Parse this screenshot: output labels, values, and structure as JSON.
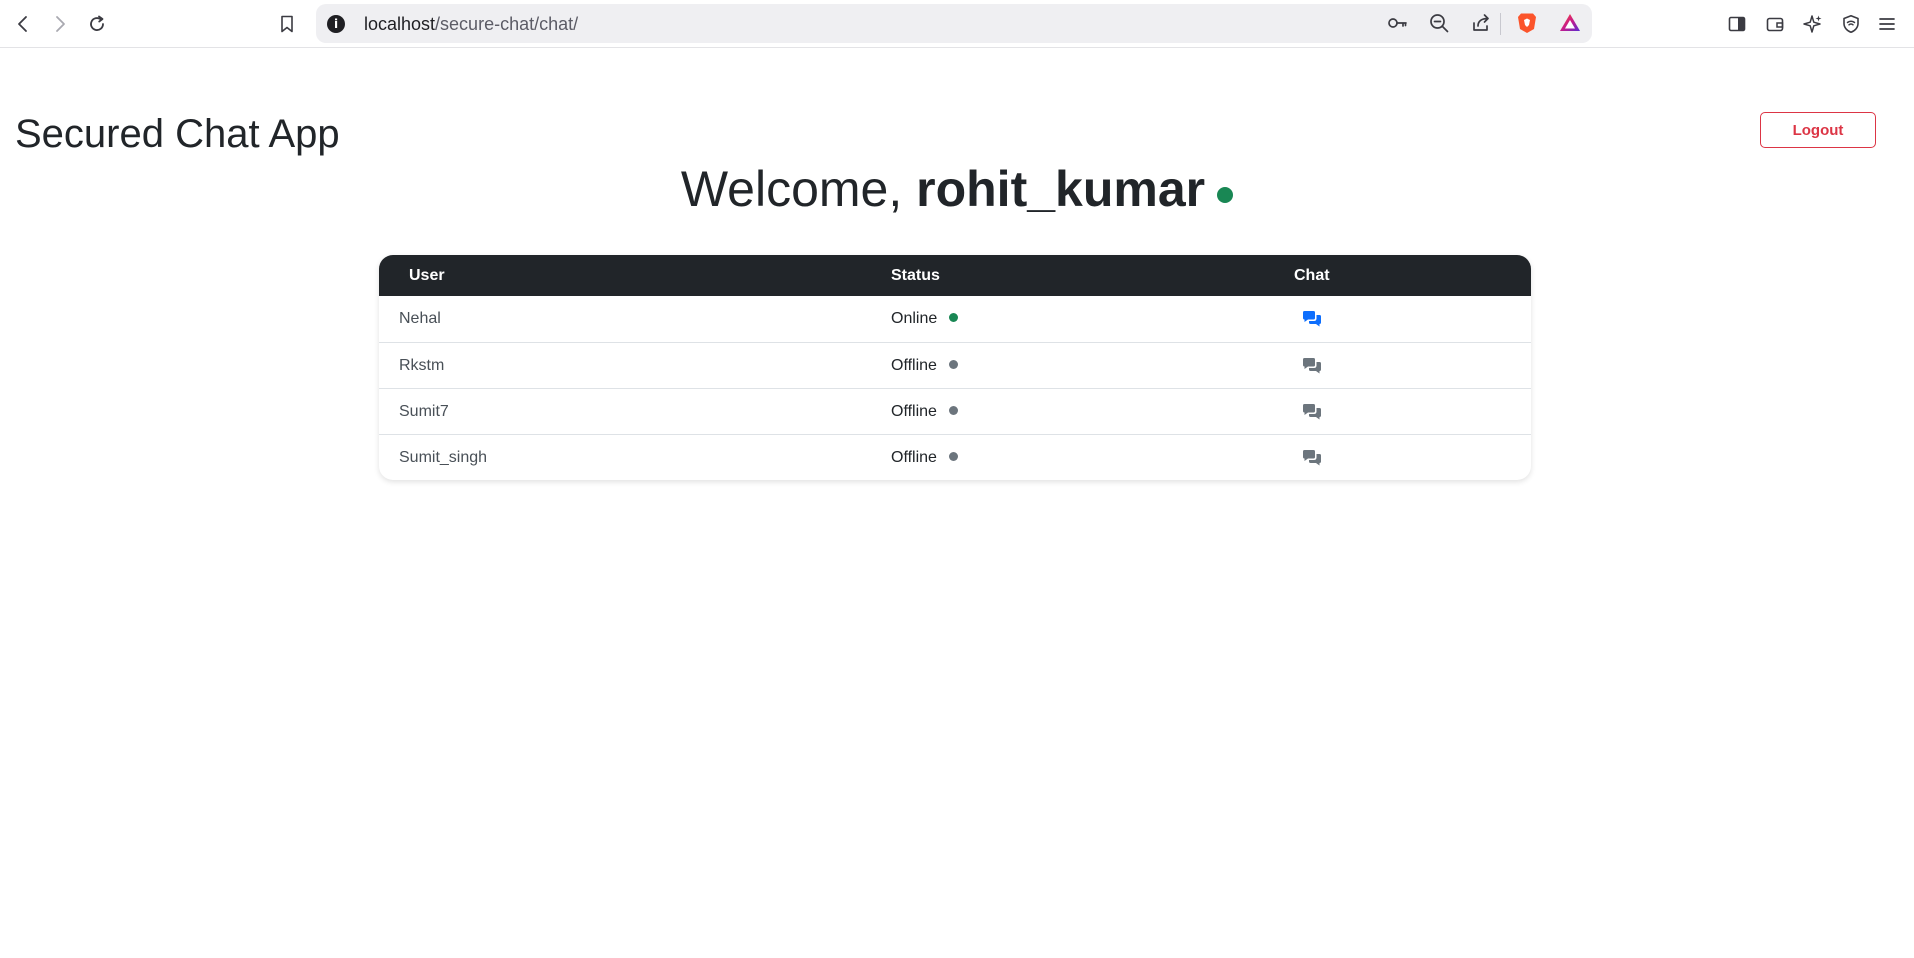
{
  "browser": {
    "url_host": "localhost",
    "url_path": "/secure-chat/chat/",
    "info_glyph": "i"
  },
  "header": {
    "app_title": "Secured Chat App",
    "logout_label": "Logout"
  },
  "welcome": {
    "prefix": "Welcome, ",
    "username": "rohit_kumar",
    "status_color": "#198754"
  },
  "table": {
    "headers": {
      "user": "User",
      "status": "Status",
      "chat": "Chat"
    },
    "rows": [
      {
        "user": "Nehal",
        "status": "Online",
        "dot_color": "#198754",
        "chat_color": "#0d6efd"
      },
      {
        "user": "Rkstm",
        "status": "Offline",
        "dot_color": "#6c757d",
        "chat_color": "#6c757d"
      },
      {
        "user": "Sumit7",
        "status": "Offline",
        "dot_color": "#6c757d",
        "chat_color": "#6c757d"
      },
      {
        "user": "Sumit_singh",
        "status": "Offline",
        "dot_color": "#6c757d",
        "chat_color": "#6c757d"
      }
    ]
  },
  "colors": {
    "danger": "#dc3545",
    "dark": "#212529",
    "online": "#198754",
    "offline": "#6c757d",
    "primary": "#0d6efd"
  }
}
